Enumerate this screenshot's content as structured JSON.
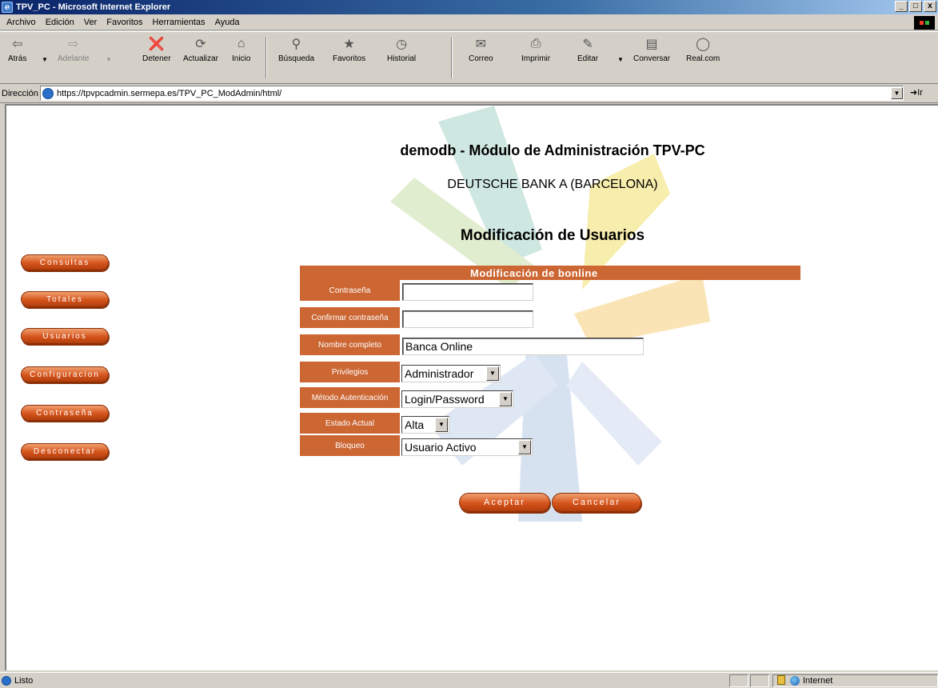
{
  "window": {
    "title": "TPV_PC - Microsoft Internet Explorer",
    "buttons": [
      "_",
      "□",
      "x"
    ]
  },
  "menu": [
    "Archivo",
    "Edición",
    "Ver",
    "Favoritos",
    "Herramientas",
    "Ayuda"
  ],
  "toolbar": {
    "back": "Atrás",
    "forward": "Adelante",
    "stop": "Detener",
    "refresh": "Actualizar",
    "home": "Inicio",
    "search": "Búsqueda",
    "favorites": "Favoritos",
    "history": "Historial",
    "mail": "Correo",
    "print": "Imprimir",
    "edit": "Editar",
    "discuss": "Conversar",
    "realcom": "Real.com"
  },
  "address": {
    "label": "Dirección",
    "url": "https://tpvpcadmin.sermepa.es/TPV_PC_ModAdmin/html/",
    "go": "Ir"
  },
  "page": {
    "app_title": "demodb - Módulo de Administración TPV-PC",
    "bank_name": "DEUTSCHE BANK A (BARCELONA)",
    "section_title": "Modificación de Usuarios"
  },
  "nav": [
    "Consultas",
    "Totales",
    "Usuarios",
    "Configuracion",
    "Contraseña",
    "Desconectar"
  ],
  "form": {
    "header": "Modificación de bonline",
    "password": {
      "label": "Contraseña",
      "value": ""
    },
    "confirm_password": {
      "label": "Confirmar contraseña",
      "value": ""
    },
    "full_name": {
      "label": "Nombre completo",
      "value": "Banca Online"
    },
    "privileges": {
      "label": "Privilegios",
      "value": "Administrador"
    },
    "auth_method": {
      "label": "Método Autenticación",
      "value": "Login/Password"
    },
    "status": {
      "label": "Estado Actual",
      "value": "Alta"
    },
    "lock": {
      "label": "Bloqueo",
      "value": "Usuario Activo"
    },
    "accept": "Aceptar",
    "cancel": "Cancelar"
  },
  "statusbar": {
    "text": "Listo",
    "zone": "Internet"
  },
  "colors": {
    "accent": "#cc6633",
    "button": "#d5541c",
    "titlebar": "#0a246a"
  }
}
